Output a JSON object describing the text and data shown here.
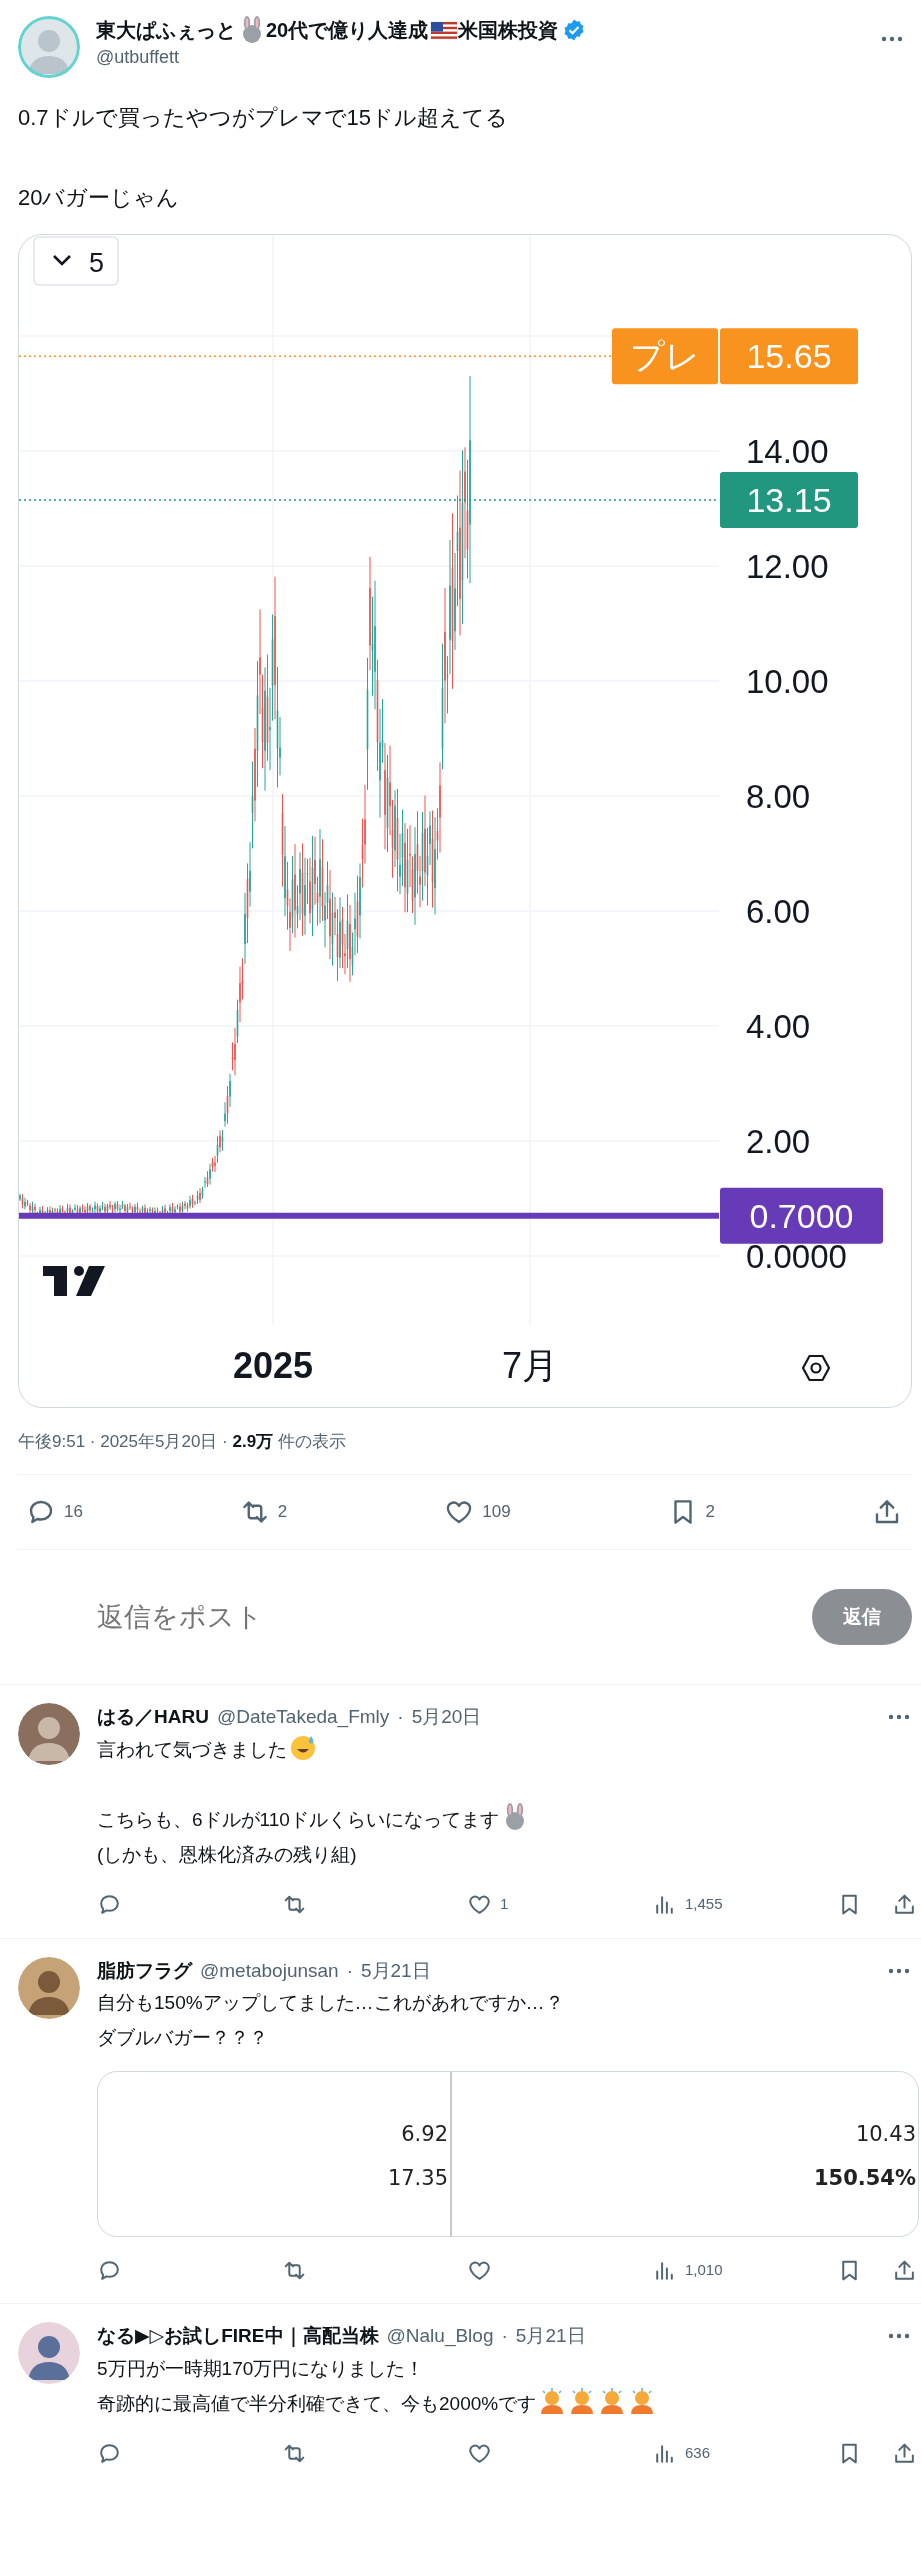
{
  "post": {
    "author": {
      "name_parts": [
        "東大ぱふぇっと",
        "20代で億り人達成",
        "米国株投資"
      ],
      "verified": true,
      "handle": "@utbuffett"
    },
    "paragraphs": [
      [
        {
          "text": "0.7ドルで買ったやつがプレマで15ドル超えてる"
        }
      ],
      [
        {
          "text": "20バガーじゃん"
        }
      ]
    ],
    "chart": {
      "interval": "5",
      "price_axis": [
        "14.00",
        "12.00",
        "10.00",
        "8.00",
        "6.00",
        "4.00",
        "2.00",
        "0.0000"
      ],
      "time_axis": [
        {
          "text": "2025",
          "kind": "year"
        },
        {
          "text": "7月",
          "kind": "month"
        }
      ],
      "tags": [
        {
          "kind": "session",
          "label": "プレ",
          "value": "15.65",
          "color": "#f7931e"
        },
        {
          "kind": "last",
          "value": "13.15",
          "color": "#22977f"
        },
        {
          "kind": "alert",
          "value": "0.7000",
          "color": "#673ab7"
        }
      ]
    },
    "meta": "午後9:51 · 2025年5月20日 · **2.9万** 件の表示",
    "actions": [
      {
        "kind": "reply",
        "count": "16"
      },
      {
        "kind": "repost",
        "count": "2"
      },
      {
        "kind": "like",
        "count": "109"
      },
      {
        "kind": "bookmark",
        "count": "2"
      },
      {
        "kind": "share"
      }
    ]
  },
  "composer": {
    "placeholder": "返信をポスト",
    "button": "返信",
    "disabled": true
  },
  "replies": [
    {
      "name": "はる／HARU",
      "handle": "@DateTakeda_Fmly",
      "separator": "·",
      "date": "5月20日",
      "paragraphs": [
        [
          {
            "text": "言われて気づきました",
            "kind": "sweat"
          }
        ],
        [
          {
            "text": "こちらも、6ドルが110ドルくらいになってます",
            "kind": "rabbit"
          },
          {
            "text": "(しかも、恩株化済みの残り組)"
          }
        ]
      ],
      "actions": [
        {
          "kind": "reply"
        },
        {
          "kind": "repost"
        },
        {
          "kind": "like",
          "count": "1"
        },
        {
          "kind": "views",
          "count": "1,455"
        },
        {
          "kind": "bookmark"
        },
        {
          "kind": "share"
        }
      ]
    },
    {
      "name": "脂肪フラグ",
      "handle": "@metabojunsan",
      "separator": "·",
      "date": "5月21日",
      "paragraphs": [
        [
          {
            "text": "自分も150%アップしてました…これがあれですか…？"
          },
          {
            "text": "ダブルバガー？？？"
          }
        ]
      ],
      "attachment": {
        "columns": [
          [
            {
              "text": "6.92",
              "bold": false
            },
            {
              "text": "17.35",
              "bold": false
            }
          ],
          [
            {
              "text": "10.43",
              "bold": false
            },
            {
              "text": "150.54%",
              "bold": true
            }
          ]
        ]
      },
      "actions": [
        {
          "kind": "reply"
        },
        {
          "kind": "repost"
        },
        {
          "kind": "like"
        },
        {
          "kind": "views",
          "count": "1,010"
        },
        {
          "kind": "bookmark"
        },
        {
          "kind": "share"
        }
      ]
    },
    {
      "name": "なる▶▷お試しFIRE中｜高配当株",
      "handle": "@Nalu_Blog",
      "separator": "·",
      "date": "5月21日",
      "paragraphs": [
        [
          {
            "text": "5万円が一時期170万円になりました！"
          },
          {
            "text": "奇跡的に最高値で半分利確できて、今も2000%です",
            "kind": "bow"
          }
        ]
      ],
      "actions": [
        {
          "kind": "reply"
        },
        {
          "kind": "repost"
        },
        {
          "kind": "like"
        },
        {
          "kind": "views",
          "count": "636"
        },
        {
          "kind": "bookmark"
        },
        {
          "kind": "share"
        }
      ]
    }
  ]
}
